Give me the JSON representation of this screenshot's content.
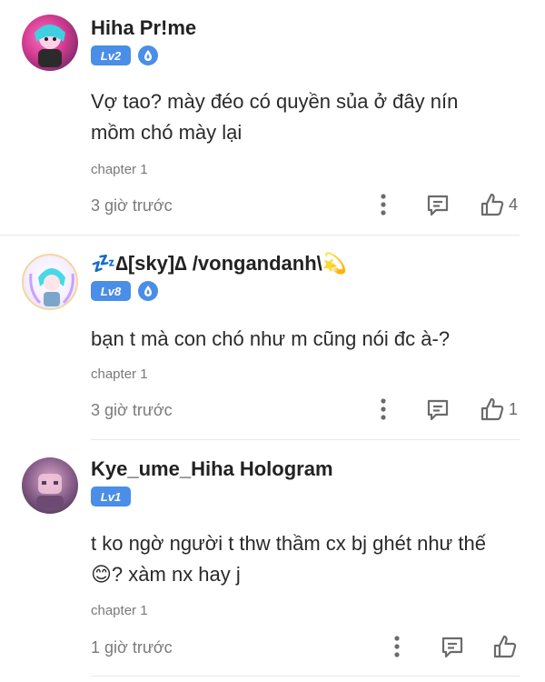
{
  "comments": [
    {
      "username": "Hiha Pr!me",
      "level": "Lv2",
      "text_lines": [
        "Vợ tao? mày đéo có quyền sủa ở đây nín",
        "mồm chó mày lại"
      ],
      "chapter": "chapter 1",
      "time": "3 giờ trước",
      "likes": "4"
    },
    {
      "username": "💤∆[sky]∆ /vongandanh\\💫",
      "level": "Lv8",
      "text_lines": [
        "bạn t mà con chó như m cũng nói đc à-?"
      ],
      "chapter": "chapter 1",
      "time": "3 giờ trước",
      "likes": "1"
    },
    {
      "username": "Kye_ume_Hiha Hologram",
      "level": "Lv1",
      "text_lines": [
        "t ko ngờ người t thw thầm cx bj ghét như thế",
        "😊? xàm nx hay j"
      ],
      "chapter": "chapter 1",
      "time": "1 giờ trước",
      "likes": ""
    }
  ]
}
